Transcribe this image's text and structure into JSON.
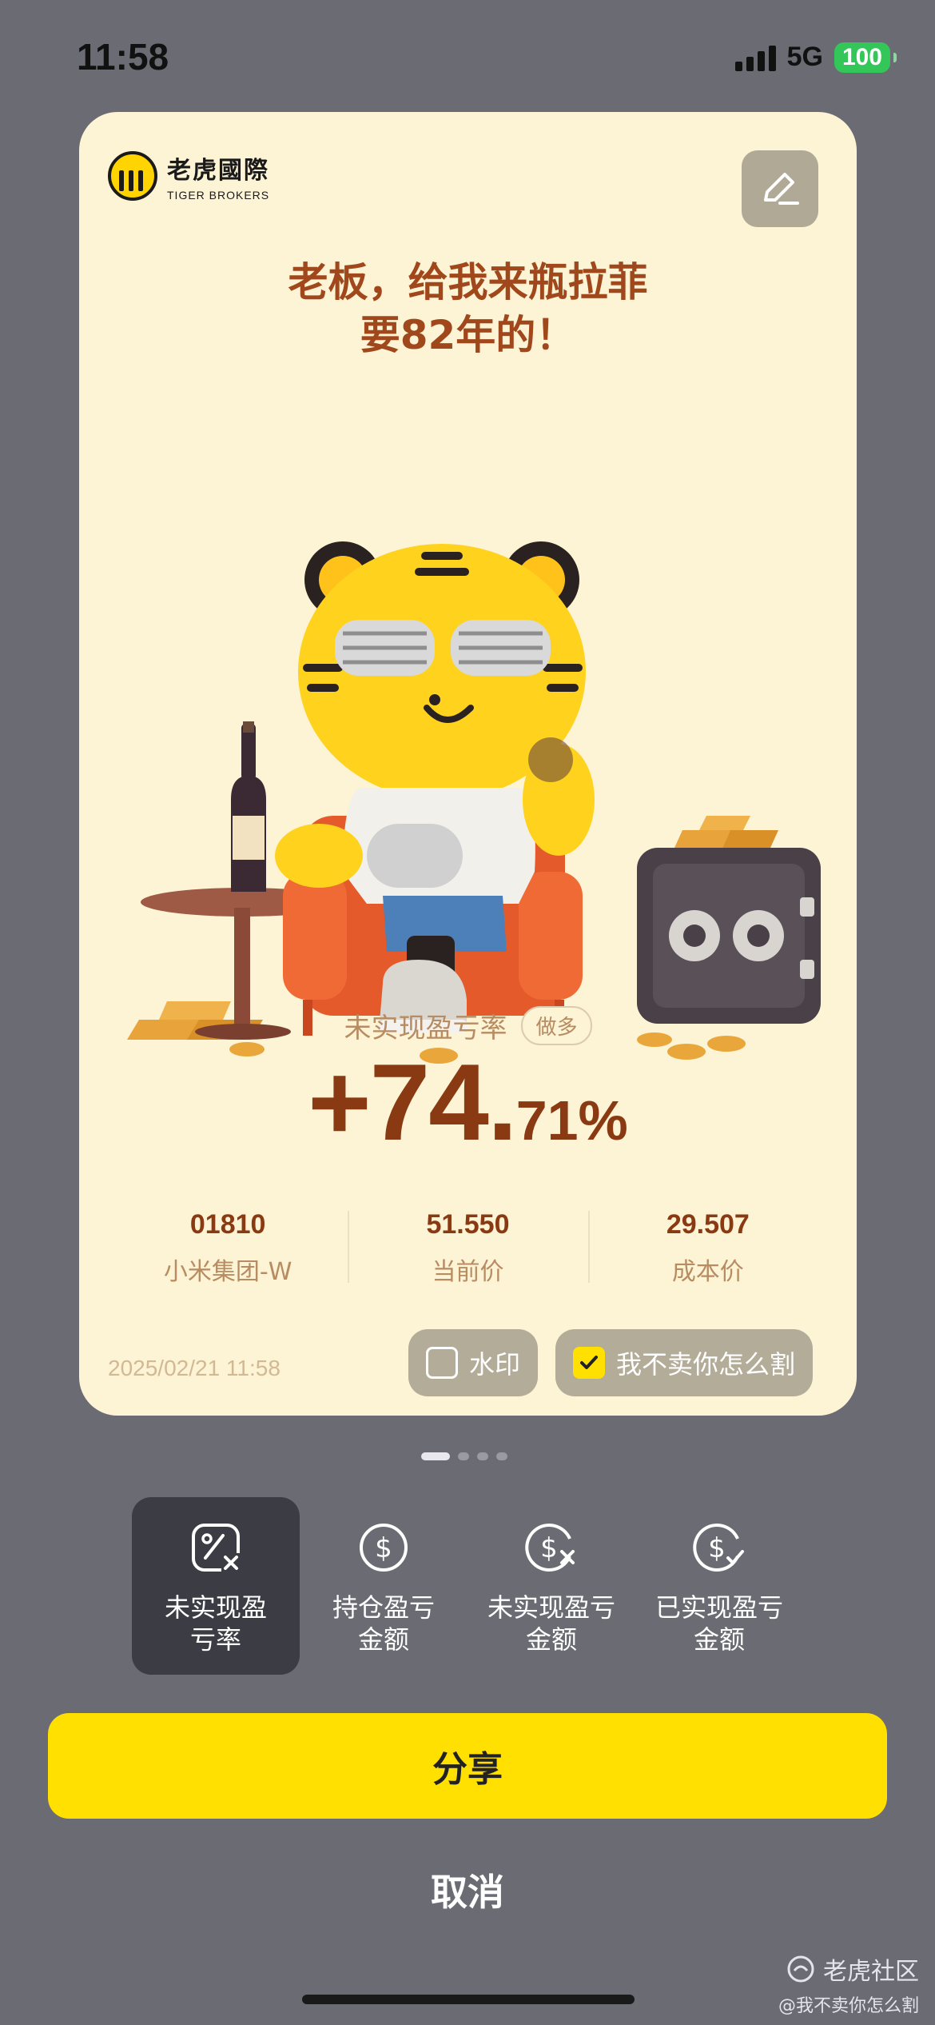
{
  "status_bar": {
    "time": "11:58",
    "network": "5G",
    "battery": "100"
  },
  "card": {
    "brand_cn": "老虎國際",
    "brand_en": "TIGER BROKERS",
    "headline_line1": "老板，给我来瓶拉菲",
    "headline_line2": "要82年的！",
    "metric_label": "未实现盈亏率",
    "metric_tag": "做多",
    "metric_value_main": "+74.",
    "metric_value_decimal": "71%",
    "stats": [
      {
        "value": "01810",
        "label": "小米集团-W"
      },
      {
        "value": "51.550",
        "label": "当前价"
      },
      {
        "value": "29.507",
        "label": "成本价"
      }
    ],
    "timestamp": "2025/02/21 11:58",
    "watermark_label": "水印",
    "watermark_checked": false,
    "deal_label": "我不卖你怎么割",
    "deal_checked": true
  },
  "pager": {
    "pages": 4,
    "active": 0
  },
  "options": [
    {
      "label": "未实现盈亏率",
      "icon": "percent-icon",
      "active": true
    },
    {
      "label": "持仓盈亏金额",
      "icon": "dollar-icon",
      "active": false
    },
    {
      "label": "未实现盈亏金额",
      "icon": "dollar-x-icon",
      "active": false
    },
    {
      "label": "已实现盈亏金额",
      "icon": "dollar-check-icon",
      "active": false
    }
  ],
  "share_label": "分享",
  "cancel_label": "取消",
  "community": {
    "name": "老虎社区",
    "user": "@我不卖你怎么割"
  },
  "colors": {
    "accent": "#ffe000",
    "card_bg": "#fdf3d5",
    "value": "#8a3a12",
    "overlay": "#6b6b73"
  }
}
